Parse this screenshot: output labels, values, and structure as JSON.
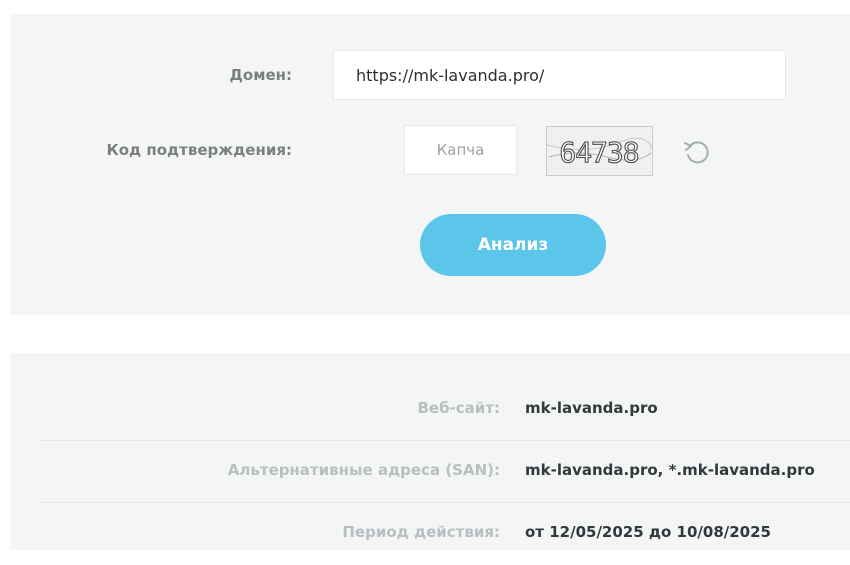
{
  "form": {
    "domain_label": "Домен:",
    "domain_value": "https://mk-lavanda.pro/",
    "captcha_label": "Код подтверждения:",
    "captcha_placeholder": "Капча",
    "captcha_image_text": "64738",
    "refresh_icon": "refresh-icon",
    "analyze_button": "Анализ"
  },
  "results": {
    "rows": [
      {
        "label": "Веб-сайт:",
        "value": "mk-lavanda.pro"
      },
      {
        "label": "Альтернативные адреса (SAN):",
        "value": "mk-lavanda.pro, *.mk-lavanda.pro"
      },
      {
        "label": "Период действия:",
        "value": "от 12/05/2025 до 10/08/2025"
      }
    ]
  },
  "colors": {
    "panel_bg": "#f4f6f6",
    "button_bg": "#5bc6ea",
    "label_color": "#7b7f82",
    "result_label_color": "#b9bec1",
    "value_color": "#33383c"
  }
}
